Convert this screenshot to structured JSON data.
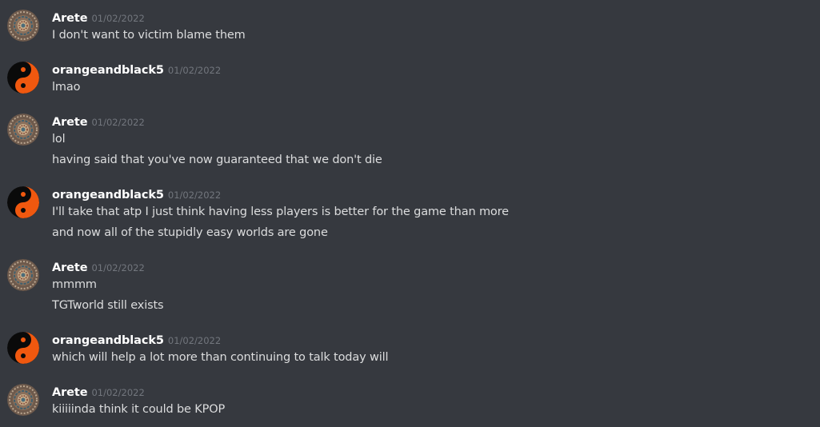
{
  "colors": {
    "background": "#36393f",
    "username": "#ffffff",
    "timestamp": "#72767d",
    "message_text": "#dcddde",
    "yin_yang_orange": "#f0580f",
    "yin_yang_black": "#0a0a0a"
  },
  "messages": [
    {
      "author": "Arete",
      "avatar_icon": "mandala-avatar-icon",
      "timestamp": "01/02/2022",
      "lines": [
        "I don't want to victim blame them"
      ]
    },
    {
      "author": "orangeandblack5",
      "avatar_icon": "yin-yang-avatar-icon",
      "timestamp": "01/02/2022",
      "lines": [
        "lmao"
      ]
    },
    {
      "author": "Arete",
      "avatar_icon": "mandala-avatar-icon",
      "timestamp": "01/02/2022",
      "lines": [
        "lol",
        "having said that you've now guaranteed that we don't die"
      ]
    },
    {
      "author": "orangeandblack5",
      "avatar_icon": "yin-yang-avatar-icon",
      "timestamp": "01/02/2022",
      "lines": [
        "I'll take that atp I just think having less players is better for the game than more",
        "and now all of the stupidly easy worlds are gone"
      ]
    },
    {
      "author": "Arete",
      "avatar_icon": "mandala-avatar-icon",
      "timestamp": "01/02/2022",
      "lines": [
        "mmmm",
        "TGTworld still exists"
      ]
    },
    {
      "author": "orangeandblack5",
      "avatar_icon": "yin-yang-avatar-icon",
      "timestamp": "01/02/2022",
      "lines": [
        "which will help a lot more than continuing to talk today will"
      ]
    },
    {
      "author": "Arete",
      "avatar_icon": "mandala-avatar-icon",
      "timestamp": "01/02/2022",
      "lines": [
        "kiiiiinda think it could be KPOP"
      ]
    }
  ]
}
